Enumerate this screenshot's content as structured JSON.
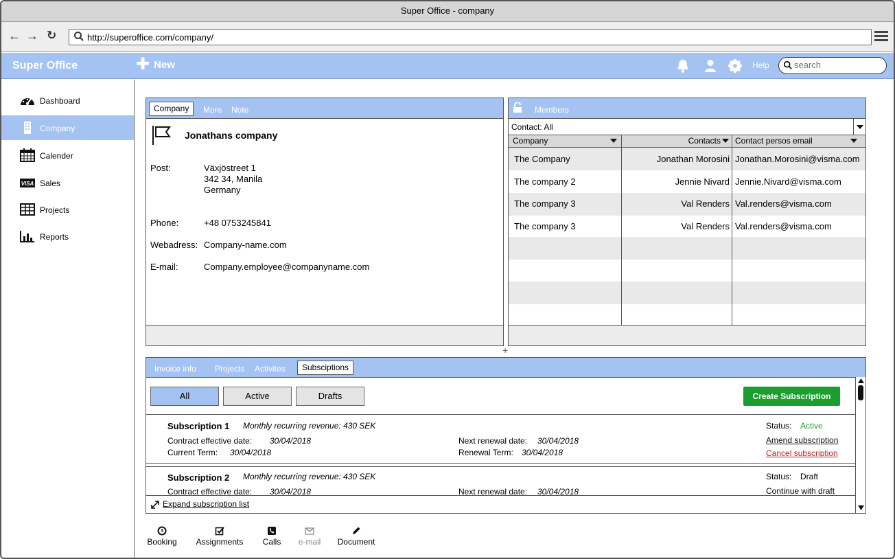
{
  "window": {
    "title": "Super Office - company"
  },
  "browser": {
    "url": "http://superoffice.com/company/"
  },
  "appbar": {
    "brand": "Super Office",
    "new_label": "New",
    "help_label": "Help",
    "search_placeholder": "search"
  },
  "sidebar": {
    "items": [
      {
        "label": "Dashboard",
        "icon": "dashboard-icon"
      },
      {
        "label": "Company",
        "icon": "building-icon",
        "active": true
      },
      {
        "label": "Calender",
        "icon": "calendar-icon"
      },
      {
        "label": "Sales",
        "icon": "visa-card-icon"
      },
      {
        "label": "Projects",
        "icon": "grid-table-icon"
      },
      {
        "label": "Reports",
        "icon": "bar-chart-icon"
      }
    ]
  },
  "company_panel": {
    "tabs": [
      "Company",
      "More",
      "Note"
    ],
    "name": "Jonathans company",
    "fields": {
      "post_label": "Post:",
      "post_lines": [
        "Växjöstreet 1",
        "342 34, Manila",
        "Germany"
      ],
      "phone_label": "Phone:",
      "phone": "+48 0753245841",
      "web_label": "Webadress:",
      "web": "Company-name.com",
      "email_label": "E-mail:",
      "email": "Company.employee@companyname.com"
    }
  },
  "members_panel": {
    "title": "Members",
    "contact_filter": "Contact: All",
    "columns": [
      "Company",
      "Contacts",
      "Contact persos email"
    ],
    "rows": [
      {
        "company": "The Company",
        "contact": "Jonathan Morosini",
        "email": "Jonathan.Morosini@visma.com"
      },
      {
        "company": "The company 2",
        "contact": "Jennie Nivard",
        "email": "Jennie.Nivard@visma.com"
      },
      {
        "company": "The company 3",
        "contact": "Val Renders",
        "email": "Val.renders@visma.com"
      },
      {
        "company": "The company 3",
        "contact": "Val Renders",
        "email": "Val.renders@visma.com"
      }
    ]
  },
  "subscriptions_panel": {
    "tabs": [
      "Invoice info",
      "Projects",
      "Activites",
      "Subsciptions"
    ],
    "filters": [
      "All",
      "Active",
      "Drafts"
    ],
    "create_label": "Create Subscription",
    "subscriptions": [
      {
        "title": "Subscription 1",
        "mrr": "Monthly recurring revenue: 430 SEK",
        "contract_label": "Contract effective date:",
        "contract_date": "30/04/2018",
        "term_label": "Current Term:",
        "term_date": "30/04/2018",
        "renewal_label": "Next renewal date:",
        "renewal_date": "30/04/2018",
        "renewal_term_label": "Renewal Term:",
        "renewal_term_date": "30/04/2018",
        "status_label": "Status:",
        "status": "Active",
        "action1": "Amend subscription",
        "action2": "Cancel subscription"
      },
      {
        "title": "Subscription 2",
        "mrr": "Monthly recurring revenue: 430 SEK",
        "contract_label": "Contract effective date:",
        "contract_date": "30/04/2018",
        "renewal_label": "Next renewal date:",
        "renewal_date": "30/04/2018",
        "status_label": "Status:",
        "status": "Draft",
        "action1": "Continue with draft"
      }
    ],
    "expand_label": "Expand subscription list"
  },
  "bottom_tools": [
    {
      "label": "Booking",
      "icon": "clock-icon"
    },
    {
      "label": "Assignments",
      "icon": "checkbox-icon"
    },
    {
      "label": "Calls",
      "icon": "phone-icon"
    },
    {
      "label": "e-mail",
      "icon": "envelope-icon",
      "disabled": true
    },
    {
      "label": "Document",
      "icon": "pencil-icon"
    }
  ],
  "colors": {
    "accent": "#a4c3f2",
    "status_active": "#1b9e2f",
    "cancel": "#b22222",
    "create_button": "#1b9e2f"
  }
}
